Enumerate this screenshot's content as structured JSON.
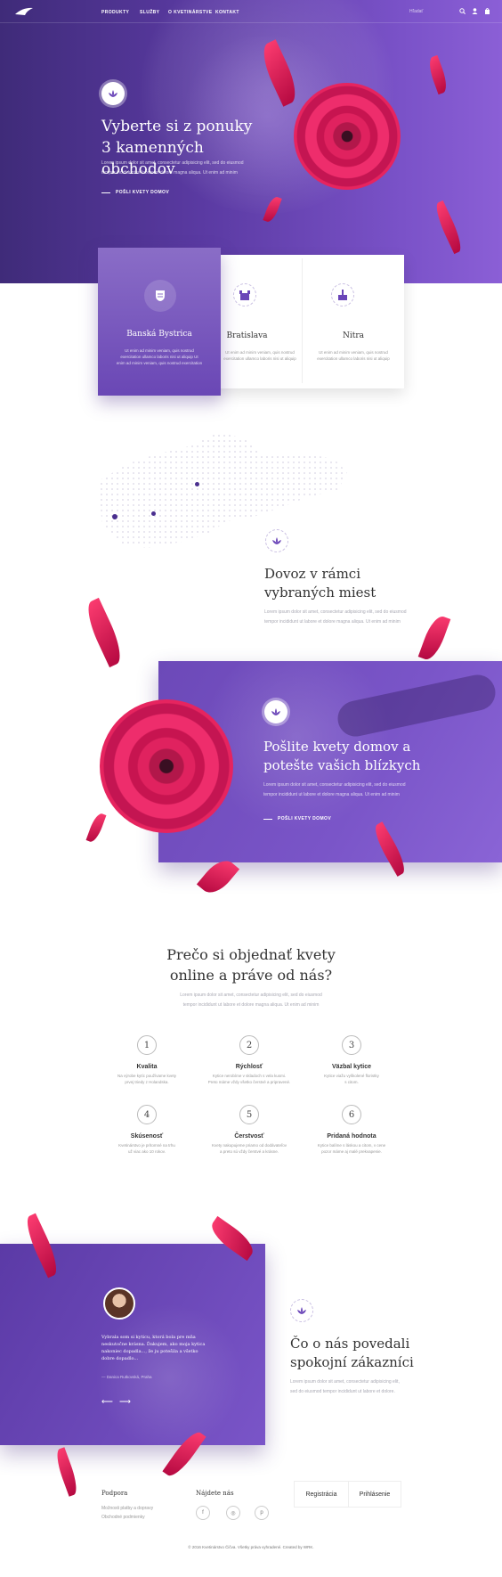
{
  "nav": {
    "items": [
      "PRODUKTY",
      "SLUŽBY",
      "O KVETINÁRSTVE",
      "KONTAKT"
    ],
    "search_placeholder": "Hľadať"
  },
  "hero": {
    "title_line1": "Vyberte si z ponuky",
    "title_line2": "3 kamenných obchodov",
    "text1": "Lorem ipsum dolor sit amet, consectetur adipisicing elit, sed do eiusmod",
    "text2": "tempor incididunt ut labore et dolore magna aliqua. Ut enim ad minim",
    "link": "POŠLI KVETY DOMOV"
  },
  "cities": [
    {
      "name": "Banská Bystrica",
      "t1": "Ut enim ad minim veniam, quis nostrud",
      "t2": "exercitation ullamco laboris nisi ut aliquip Ut",
      "t3": "enim ad minim veniam, quis nostrud exercitation"
    },
    {
      "name": "Bratislava",
      "t1": "Ut enim ad minim veniam, quis nostrud",
      "t2": "exercitation ullamco laboris nisi ut aliquip",
      "t3": ""
    },
    {
      "name": "Nitra",
      "t1": "Ut enim ad minim veniam, quis nostrud",
      "t2": "exercitation ullamco laboris nisi ut aliquip",
      "t3": ""
    }
  ],
  "delivery": {
    "title_line1": "Dovoz v rámci",
    "title_line2": "vybraných miest",
    "text1": "Lorem ipsum dolor sit amet, consectetur adipisicing elit, sed do eiusmod",
    "text2": "tempor incididunt ut labore et dolore magna aliqua. Ut enim ad minim"
  },
  "send": {
    "title_line1": "Pošlite kvety domov a",
    "title_line2": "potešte vašich blízkych",
    "text1": "Lorem ipsum dolor sit amet, consectetur adipisicing elit, sed do eiusmod",
    "text2": "tempor incididunt ut labore et dolore magna aliqua. Ut enim ad minim",
    "link": "POŠLI KVETY DOMOV"
  },
  "why": {
    "title_line1": "Prečo si objednať kvety",
    "title_line2": "online a práve od nás?",
    "text1": "Lorem ipsum dolor sit amet, consectetur adipisicing elit, sed do eiusmod",
    "text2": "tempor incididunt ut labore et dolore magna aliqua. Ut enim ad minim"
  },
  "features": [
    {
      "num": "1",
      "title": "Kvalita",
      "d1": "Na výrobe kytíc používame kvety",
      "d2": "prvej triedy z Holandska."
    },
    {
      "num": "2",
      "title": "Rýchlosť",
      "d1": "Kytice nerobíme v skladoch s vela kusmi.",
      "d2": "Preto máme vždy všetko čerstvé a pripravené."
    },
    {
      "num": "3",
      "title": "Väzbal kytice",
      "d1": "Kytice viažu vyškolené floristky",
      "d2": "s citom."
    },
    {
      "num": "4",
      "title": "Skúsenosť",
      "d1": "Kvetinárstvo je prítomné na trhu",
      "d2": "už viac ako 10 rokov."
    },
    {
      "num": "5",
      "title": "Čerstvosť",
      "d1": "Kvety nakupujeme priamo od dodávateľov",
      "d2": "a preto sú vždy čerstvé a krásne."
    },
    {
      "num": "6",
      "title": "Pridaná hodnota",
      "d1": "Kytice balíme s láskou a citom, v cene",
      "d2": "pozor máme aj malé prekvapenie."
    }
  ],
  "testimonial": {
    "q1": "Vybrala som si kyticu, ktorá bola pre mňa",
    "q2": "neskutočne krásna. Ďakujem, ako moja kytica",
    "q3": "nakoniec dopadla..., že ju potešila a všetko",
    "q4": "dobre dopadlo...",
    "q5": "Ďakujem.",
    "author": "— Danica Rutkovská, Praha"
  },
  "reviews": {
    "title_line1": "Čo o nás povedali",
    "title_line2": "spokojní zákazníci",
    "text1": "Lorem ipsum dolor sit amet, consectetur adipisicing elit,",
    "text2": "sed do eiusmod tempor incididunt ut labore et dolore."
  },
  "footer": {
    "support_title": "Podpora",
    "support_links": [
      "Možnosti platby a dopravy",
      "Obchodné podmienky"
    ],
    "find_title": "Nájdete nás",
    "register": "Registrácia",
    "login": "Prihlásenie",
    "copyright": "© 2016 Kvetinárstvo Čičva. Všetky práva vyhradené. Created by WRK."
  },
  "colors": {
    "purple": "#6a45b8",
    "pink": "#e0225f"
  }
}
